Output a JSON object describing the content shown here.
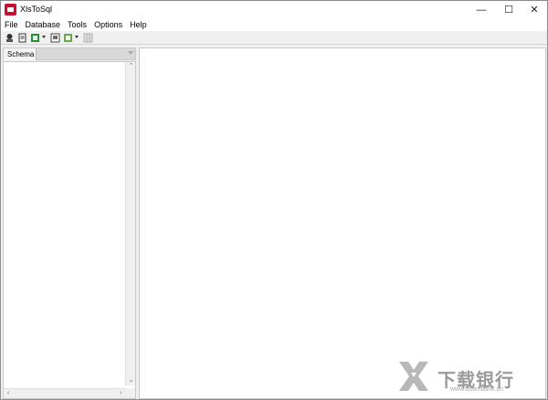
{
  "window": {
    "title": "XlsToSql",
    "minimize_glyph": "—",
    "maximize_glyph": "☐",
    "close_glyph": "✕"
  },
  "menu": {
    "items": [
      "File",
      "Database",
      "Tools",
      "Options",
      "Help"
    ]
  },
  "toolbar": {
    "buttons": [
      {
        "icon": "connect-icon",
        "glyph": "⚙"
      },
      {
        "icon": "script-icon",
        "glyph": "📜"
      },
      {
        "icon": "import-excel-icon",
        "glyph": "▣"
      },
      {
        "icon": "preview-icon",
        "glyph": "▦"
      },
      {
        "icon": "export-icon",
        "glyph": "▩"
      },
      {
        "icon": "grid-icon",
        "glyph": "▥"
      }
    ]
  },
  "left_panel": {
    "tab_label": "Schema",
    "scroll_up": "⌃",
    "scroll_down": "⌄",
    "scroll_left": "‹",
    "scroll_right": "›"
  },
  "watermark": {
    "text": "下载银行",
    "subtext": "www.downbank.cn"
  },
  "colors": {
    "brand": "#c8102e",
    "watermark": "#9a9a9a"
  }
}
